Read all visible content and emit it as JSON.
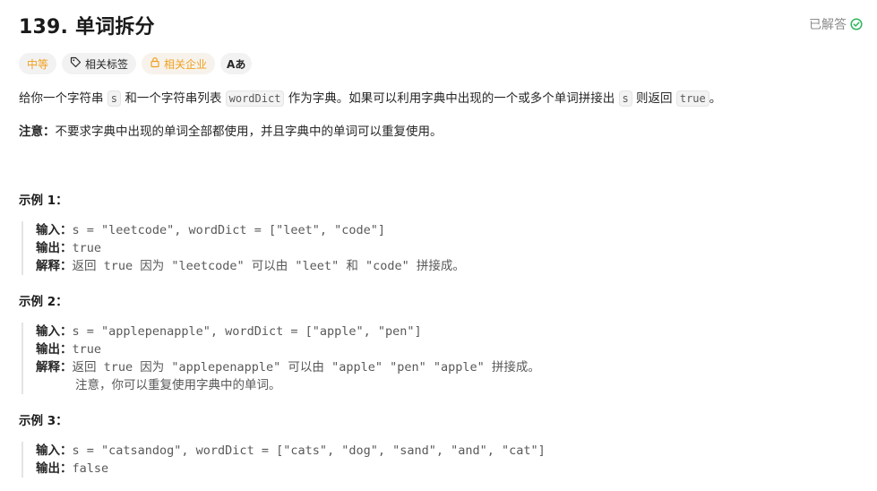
{
  "problem": {
    "title": "139. 单词拆分",
    "solved_label": "已解答"
  },
  "tags": {
    "difficulty": "中等",
    "related_tags": "相关标签",
    "related_companies": "相关企业",
    "lang": "Aあ"
  },
  "description": {
    "p1": "给你一个字符串 ",
    "s": "s",
    "p2": " 和一个字符串列表 ",
    "wordDict": "wordDict",
    "p3": " 作为字典。如果可以利用字典中出现的一个或多个单词拼接出 ",
    "s2": "s",
    "p4": " 则返回 ",
    "true": "true",
    "p5": "。"
  },
  "note": {
    "label": "注意：",
    "text": "不要求字典中出现的单词全部都使用，并且字典中的单词可以重复使用。"
  },
  "examples": [
    {
      "title": "示例 1：",
      "input_label": "输入：",
      "input": "s = \"leetcode\", wordDict = [\"leet\", \"code\"]",
      "output_label": "输出：",
      "output": "true",
      "explain_label": "解释：",
      "explain": "返回 true 因为 \"leetcode\" 可以由 \"leet\" 和 \"code\" 拼接成。"
    },
    {
      "title": "示例 2：",
      "input_label": "输入：",
      "input": "s = \"applepenapple\", wordDict = [\"apple\", \"pen\"]",
      "output_label": "输出：",
      "output": "true",
      "explain_label": "解释：",
      "explain": "返回 true 因为 \"applepenapple\" 可以由 \"apple\" \"pen\" \"apple\" 拼接成。",
      "explain_extra": "注意，你可以重复使用字典中的单词。"
    },
    {
      "title": "示例 3：",
      "input_label": "输入：",
      "input": "s = \"catsandog\", wordDict = [\"cats\", \"dog\", \"sand\", \"and\", \"cat\"]",
      "output_label": "输出：",
      "output": "false"
    }
  ]
}
